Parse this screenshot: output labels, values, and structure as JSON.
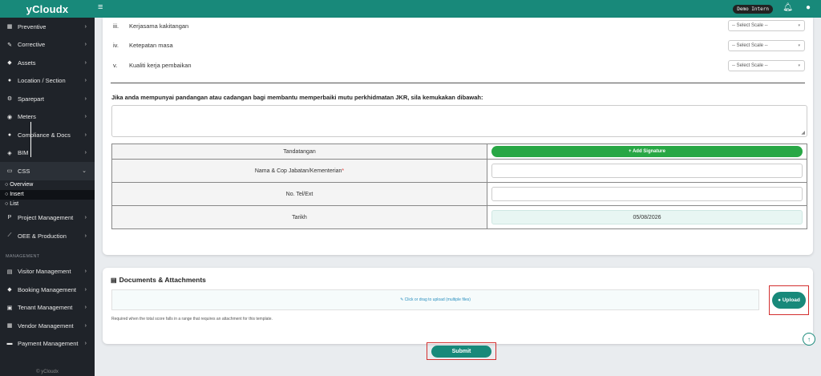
{
  "sidebar": {
    "brand": "yCloudx",
    "items": [
      {
        "label": "Preventive",
        "icon": "calendar-icon"
      },
      {
        "label": "Corrective",
        "icon": "wrench-icon"
      },
      {
        "label": "Assets",
        "icon": "tag-icon"
      },
      {
        "label": "Location / Section",
        "icon": "location-icon"
      },
      {
        "label": "Sparepart",
        "icon": "sparepart-icon"
      },
      {
        "label": "Meters",
        "icon": "meter-icon"
      },
      {
        "label": "Compliance & Docs",
        "icon": "compliance-icon"
      },
      {
        "label": "BIM",
        "icon": "cube-icon"
      },
      {
        "label": "CSS",
        "icon": "monitor-icon"
      }
    ],
    "css_sub": [
      "Overview",
      "Insert",
      "List"
    ],
    "items2": [
      {
        "label": "Project Management",
        "icon": "project-icon"
      },
      {
        "label": "OEE & Production",
        "icon": "chart-line-icon"
      }
    ],
    "section_label": "MANAGEMENT",
    "items3": [
      {
        "label": "Visitor Management",
        "icon": "visitor-icon"
      },
      {
        "label": "Booking Management",
        "icon": "booking-icon"
      },
      {
        "label": "Tenant Management",
        "icon": "tenant-icon"
      },
      {
        "label": "Vendor Management",
        "icon": "vendor-icon"
      },
      {
        "label": "Payment Management",
        "icon": "payment-icon"
      }
    ],
    "footer": "© yCloudx"
  },
  "topbar": {
    "user": "Demo Intern",
    "icons": [
      "hamburger-icon",
      "bell-icon",
      "user-icon"
    ]
  },
  "scale_rows": [
    {
      "num": "iii.",
      "label": "Kerjasama kakitangan",
      "select": "-- Select Scale --"
    },
    {
      "num": "iv.",
      "label": "Ketepatan masa",
      "select": "-- Select Scale --"
    },
    {
      "num": "v.",
      "label": "Kualiti kerja pembaikan",
      "select": "-- Select Scale --"
    }
  ],
  "feedback_prompt": "Jika anda mempunyai pandangan atau cadangan bagi membantu memperbaiki mutu perkhidmatan JKR, sila kemukakan dibawah:",
  "signature_table": {
    "tandatangan": "Tandatangan",
    "add_signature": "+ Add Signature",
    "nama": "Nama & Cop Jabatan/Kementerian",
    "required_mark": "*",
    "tel": "No. Tel/Ext",
    "tarikh": "Tarikh",
    "date_value": "05/08/2026"
  },
  "documents": {
    "title": "Documents & Attachments",
    "dropzone": "✎ Click or drag to upload (multiple files)",
    "upload": "Upload",
    "note": "Required when the total score falls in a range that requires an attachment for this template."
  },
  "submit": "Submit",
  "colors": {
    "primary": "#18897a",
    "sidebar": "#1f2329",
    "green": "#28a745",
    "highlight": "#d32f2f"
  }
}
